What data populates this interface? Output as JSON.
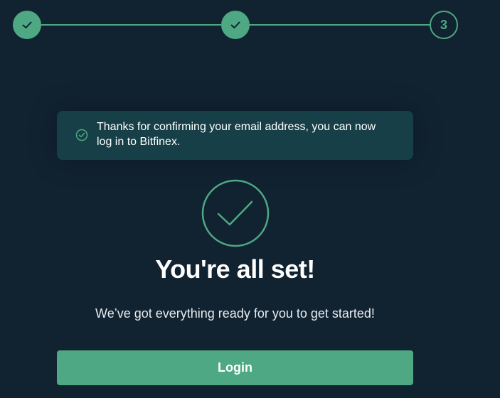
{
  "colors": {
    "background": "#112231",
    "accent": "#4ea883",
    "alert_background": "#173f47",
    "text": "#ffffff"
  },
  "stepper": {
    "steps": [
      {
        "state": "completed",
        "icon": "check-icon"
      },
      {
        "state": "completed",
        "icon": "check-icon"
      },
      {
        "state": "current",
        "label": "3"
      }
    ]
  },
  "alert": {
    "icon": "check-circle-icon",
    "message": "Thanks for confirming your email address, you can now log in to Bitfinex."
  },
  "main": {
    "icon": "check-circle-large-icon",
    "title": "You're all set!",
    "subtitle": "We’ve got everything ready for you to get started!",
    "login_label": "Login"
  }
}
